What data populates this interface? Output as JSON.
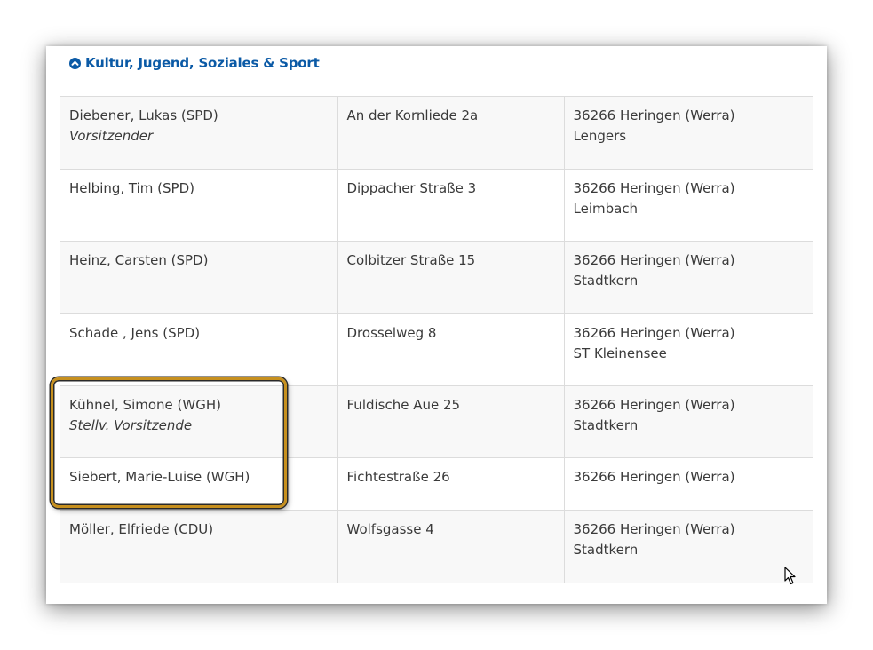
{
  "section": {
    "title": "Kultur, Jugend, Soziales & Sport",
    "icon": "chevron-up-circle-icon",
    "accent_color": "#0b5aa6"
  },
  "members": [
    {
      "name": "Diebener, Lukas (SPD)",
      "role": "Vorsitzender",
      "street": "An der Kornliede 2a",
      "city": "36266 Heringen (Werra)",
      "district": "Lengers"
    },
    {
      "name": "Helbing, Tim (SPD)",
      "role": "",
      "street": "Dippacher Straße 3",
      "city": "36266 Heringen (Werra)",
      "district": "Leimbach"
    },
    {
      "name": "Heinz, Carsten (SPD)",
      "role": "",
      "street": "Colbitzer Straße 15",
      "city": "36266 Heringen (Werra)",
      "district": "Stadtkern"
    },
    {
      "name": "Schade , Jens (SPD)",
      "role": "",
      "street": "Drosselweg 8",
      "city": "36266 Heringen (Werra)",
      "district": "ST Kleinensee"
    },
    {
      "name": "Kühnel, Simone (WGH)",
      "role": "Stellv. Vorsitzende",
      "street": "Fuldische Aue 25",
      "city": "36266 Heringen (Werra)",
      "district": "Stadtkern"
    },
    {
      "name": "Siebert, Marie-Luise (WGH)",
      "role": "",
      "street": "Fichtestraße 26",
      "city": "36266 Heringen (Werra)",
      "district": ""
    },
    {
      "name": "Möller, Elfriede (CDU)",
      "role": "",
      "street": "Wolfsgasse 4",
      "city": "36266 Heringen (Werra)",
      "district": "Stadtkern"
    }
  ],
  "highlight_color": "#c7901e"
}
